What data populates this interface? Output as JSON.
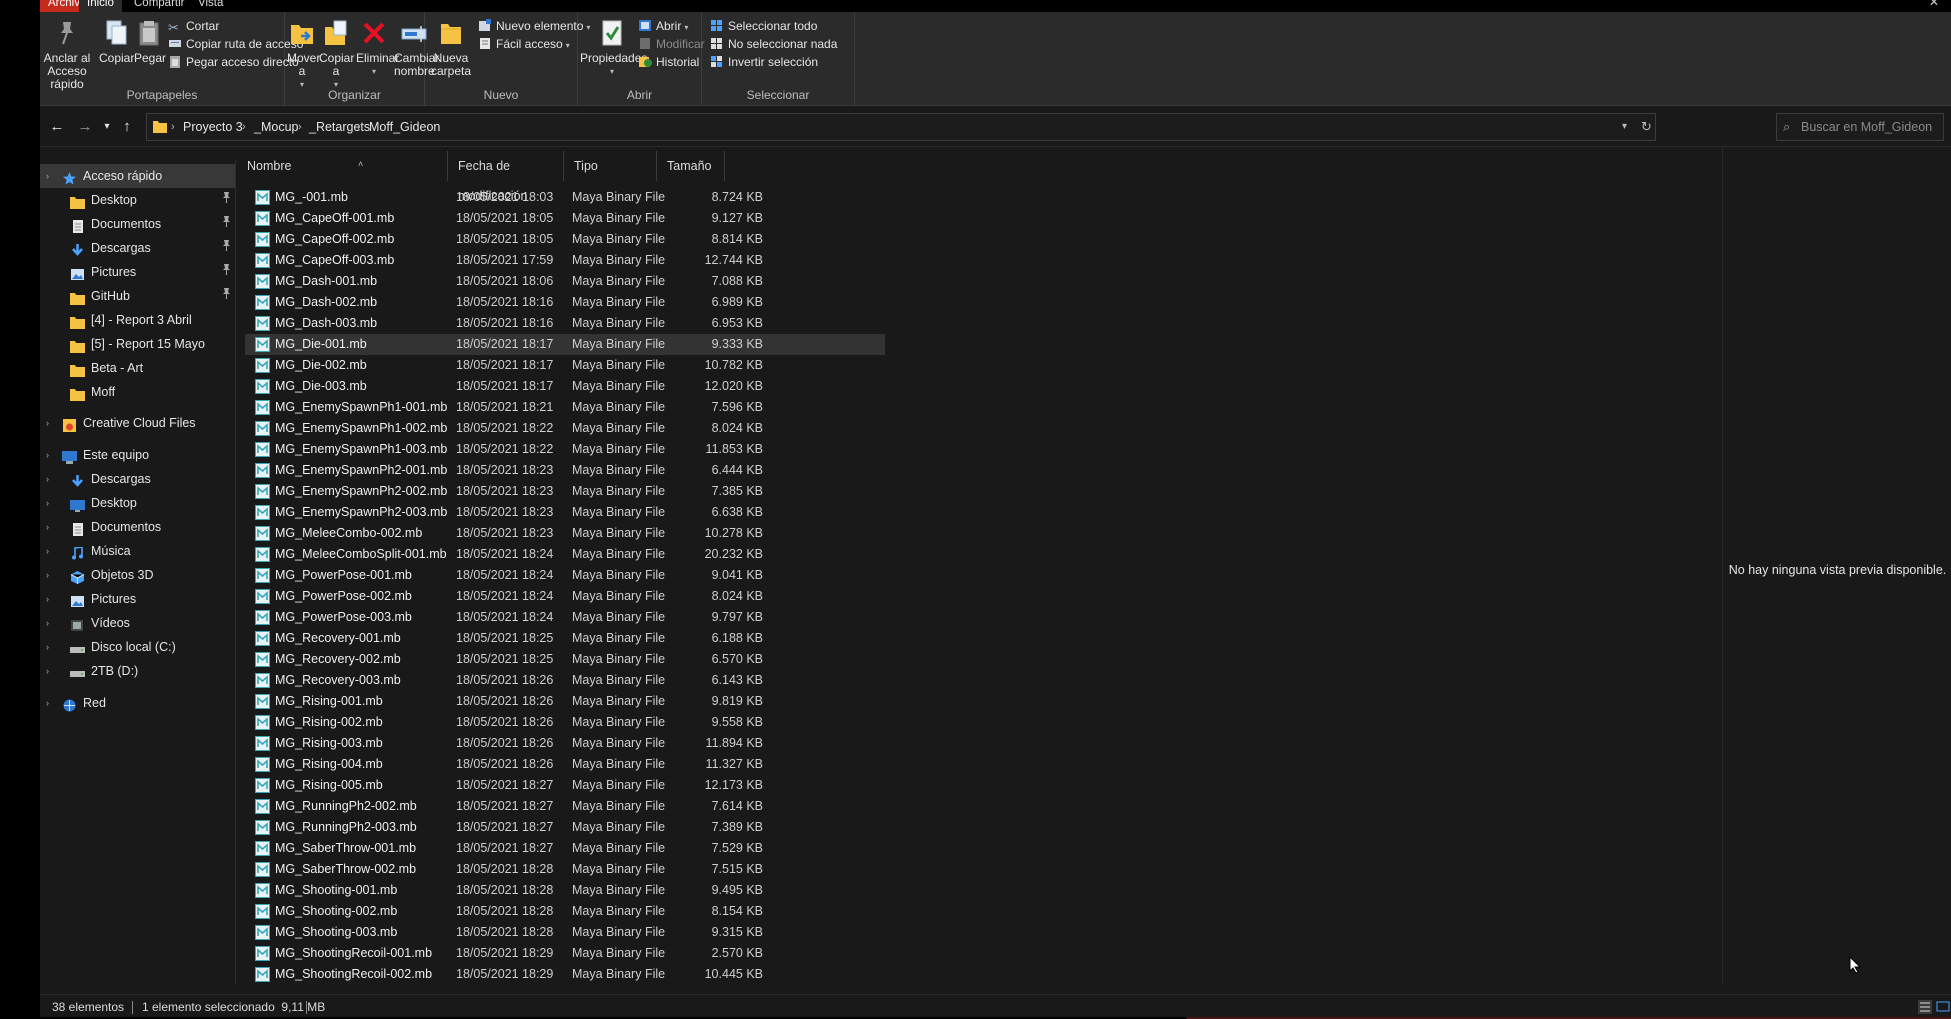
{
  "ribbon_tabs": [
    "Archivo",
    "Inicio",
    "Compartir",
    "Vista"
  ],
  "ribbon": {
    "portapapeles": {
      "label": "Portapapeles",
      "pin_label_1": "Anclar al",
      "pin_label_2": "Acceso rápido",
      "copy": "Copiar",
      "paste": "Pegar",
      "cut": "Cortar",
      "copy_path": "Copiar ruta de acceso",
      "paste_shortcut": "Pegar acceso directo"
    },
    "organizar": {
      "label": "Organizar",
      "move_1": "Mover",
      "move_2": "a",
      "copy_1": "Copiar",
      "copy_2": "a",
      "delete": "Eliminar",
      "rename_1": "Cambiar",
      "rename_2": "nombre"
    },
    "nuevo": {
      "label": "Nuevo",
      "new_folder_1": "Nueva",
      "new_folder_2": "carpeta",
      "new_item": "Nuevo elemento",
      "easy_access": "Fácil acceso"
    },
    "abrir": {
      "label": "Abrir",
      "properties": "Propiedades",
      "open": "Abrir",
      "edit": "Modificar",
      "history": "Historial"
    },
    "seleccionar": {
      "label": "Seleccionar",
      "select_all": "Seleccionar todo",
      "select_none": "No seleccionar nada",
      "invert": "Invertir selección"
    }
  },
  "breadcrumb": [
    "Proyecto 3",
    "_Mocup",
    "_Retargets",
    "Moff_Gideon"
  ],
  "search_placeholder": "Buscar en Moff_Gideon",
  "sidebar": {
    "quick_access": "Acceso rápido",
    "quick_items": [
      {
        "label": "Desktop",
        "icon": "folder-icon",
        "pinned": true
      },
      {
        "label": "Documentos",
        "icon": "documents-icon",
        "pinned": true
      },
      {
        "label": "Descargas",
        "icon": "download-icon",
        "pinned": true
      },
      {
        "label": "Pictures",
        "icon": "pictures-icon",
        "pinned": true
      },
      {
        "label": "GitHub",
        "icon": "folder-icon",
        "pinned": true
      },
      {
        "label": "[4] - Report 3 Abril",
        "icon": "folder-icon",
        "pinned": false
      },
      {
        "label": "[5] - Report 15 Mayo",
        "icon": "folder-icon",
        "pinned": false
      },
      {
        "label": "Beta - Art",
        "icon": "folder-icon",
        "pinned": false
      },
      {
        "label": "Moff",
        "icon": "folder-icon",
        "pinned": false
      }
    ],
    "creative_cloud": "Creative Cloud Files",
    "this_pc": "Este equipo",
    "pc_items": [
      {
        "label": "Descargas",
        "icon": "download-icon"
      },
      {
        "label": "Desktop",
        "icon": "desktop-icon"
      },
      {
        "label": "Documentos",
        "icon": "documents-icon"
      },
      {
        "label": "Música",
        "icon": "music-icon"
      },
      {
        "label": "Objetos 3D",
        "icon": "objects3d-icon"
      },
      {
        "label": "Pictures",
        "icon": "pictures-icon"
      },
      {
        "label": "Vídeos",
        "icon": "videos-icon"
      },
      {
        "label": "Disco local (C:)",
        "icon": "drive-icon"
      },
      {
        "label": "2TB (D:)",
        "icon": "drive-icon"
      }
    ],
    "network": "Red"
  },
  "columns": {
    "name": "Nombre",
    "date": "Fecha de modificación",
    "type": "Tipo",
    "size": "Tamaño"
  },
  "files": [
    {
      "name": "MG_-001.mb",
      "date": "18/05/2021 18:03",
      "type": "Maya Binary File",
      "size": "8.724 KB"
    },
    {
      "name": "MG_CapeOff-001.mb",
      "date": "18/05/2021 18:05",
      "type": "Maya Binary File",
      "size": "9.127 KB"
    },
    {
      "name": "MG_CapeOff-002.mb",
      "date": "18/05/2021 18:05",
      "type": "Maya Binary File",
      "size": "8.814 KB"
    },
    {
      "name": "MG_CapeOff-003.mb",
      "date": "18/05/2021 17:59",
      "type": "Maya Binary File",
      "size": "12.744 KB"
    },
    {
      "name": "MG_Dash-001.mb",
      "date": "18/05/2021 18:06",
      "type": "Maya Binary File",
      "size": "7.088 KB"
    },
    {
      "name": "MG_Dash-002.mb",
      "date": "18/05/2021 18:16",
      "type": "Maya Binary File",
      "size": "6.989 KB"
    },
    {
      "name": "MG_Dash-003.mb",
      "date": "18/05/2021 18:16",
      "type": "Maya Binary File",
      "size": "6.953 KB"
    },
    {
      "name": "MG_Die-001.mb",
      "date": "18/05/2021 18:17",
      "type": "Maya Binary File",
      "size": "9.333 KB"
    },
    {
      "name": "MG_Die-002.mb",
      "date": "18/05/2021 18:17",
      "type": "Maya Binary File",
      "size": "10.782 KB"
    },
    {
      "name": "MG_Die-003.mb",
      "date": "18/05/2021 18:17",
      "type": "Maya Binary File",
      "size": "12.020 KB"
    },
    {
      "name": "MG_EnemySpawnPh1-001.mb",
      "date": "18/05/2021 18:21",
      "type": "Maya Binary File",
      "size": "7.596 KB"
    },
    {
      "name": "MG_EnemySpawnPh1-002.mb",
      "date": "18/05/2021 18:22",
      "type": "Maya Binary File",
      "size": "8.024 KB"
    },
    {
      "name": "MG_EnemySpawnPh1-003.mb",
      "date": "18/05/2021 18:22",
      "type": "Maya Binary File",
      "size": "11.853 KB"
    },
    {
      "name": "MG_EnemySpawnPh2-001.mb",
      "date": "18/05/2021 18:23",
      "type": "Maya Binary File",
      "size": "6.444 KB"
    },
    {
      "name": "MG_EnemySpawnPh2-002.mb",
      "date": "18/05/2021 18:23",
      "type": "Maya Binary File",
      "size": "7.385 KB"
    },
    {
      "name": "MG_EnemySpawnPh2-003.mb",
      "date": "18/05/2021 18:23",
      "type": "Maya Binary File",
      "size": "6.638 KB"
    },
    {
      "name": "MG_MeleeCombo-002.mb",
      "date": "18/05/2021 18:23",
      "type": "Maya Binary File",
      "size": "10.278 KB"
    },
    {
      "name": "MG_MeleeComboSplit-001.mb",
      "date": "18/05/2021 18:24",
      "type": "Maya Binary File",
      "size": "20.232 KB"
    },
    {
      "name": "MG_PowerPose-001.mb",
      "date": "18/05/2021 18:24",
      "type": "Maya Binary File",
      "size": "9.041 KB"
    },
    {
      "name": "MG_PowerPose-002.mb",
      "date": "18/05/2021 18:24",
      "type": "Maya Binary File",
      "size": "8.024 KB"
    },
    {
      "name": "MG_PowerPose-003.mb",
      "date": "18/05/2021 18:24",
      "type": "Maya Binary File",
      "size": "9.797 KB"
    },
    {
      "name": "MG_Recovery-001.mb",
      "date": "18/05/2021 18:25",
      "type": "Maya Binary File",
      "size": "6.188 KB"
    },
    {
      "name": "MG_Recovery-002.mb",
      "date": "18/05/2021 18:25",
      "type": "Maya Binary File",
      "size": "6.570 KB"
    },
    {
      "name": "MG_Recovery-003.mb",
      "date": "18/05/2021 18:26",
      "type": "Maya Binary File",
      "size": "6.143 KB"
    },
    {
      "name": "MG_Rising-001.mb",
      "date": "18/05/2021 18:26",
      "type": "Maya Binary File",
      "size": "9.819 KB"
    },
    {
      "name": "MG_Rising-002.mb",
      "date": "18/05/2021 18:26",
      "type": "Maya Binary File",
      "size": "9.558 KB"
    },
    {
      "name": "MG_Rising-003.mb",
      "date": "18/05/2021 18:26",
      "type": "Maya Binary File",
      "size": "11.894 KB"
    },
    {
      "name": "MG_Rising-004.mb",
      "date": "18/05/2021 18:26",
      "type": "Maya Binary File",
      "size": "11.327 KB"
    },
    {
      "name": "MG_Rising-005.mb",
      "date": "18/05/2021 18:27",
      "type": "Maya Binary File",
      "size": "12.173 KB"
    },
    {
      "name": "MG_RunningPh2-002.mb",
      "date": "18/05/2021 18:27",
      "type": "Maya Binary File",
      "size": "7.614 KB"
    },
    {
      "name": "MG_RunningPh2-003.mb",
      "date": "18/05/2021 18:27",
      "type": "Maya Binary File",
      "size": "7.389 KB"
    },
    {
      "name": "MG_SaberThrow-001.mb",
      "date": "18/05/2021 18:27",
      "type": "Maya Binary File",
      "size": "7.529 KB"
    },
    {
      "name": "MG_SaberThrow-002.mb",
      "date": "18/05/2021 18:28",
      "type": "Maya Binary File",
      "size": "7.515 KB"
    },
    {
      "name": "MG_Shooting-001.mb",
      "date": "18/05/2021 18:28",
      "type": "Maya Binary File",
      "size": "9.495 KB"
    },
    {
      "name": "MG_Shooting-002.mb",
      "date": "18/05/2021 18:28",
      "type": "Maya Binary File",
      "size": "8.154 KB"
    },
    {
      "name": "MG_Shooting-003.mb",
      "date": "18/05/2021 18:28",
      "type": "Maya Binary File",
      "size": "9.315 KB"
    },
    {
      "name": "MG_ShootingRecoil-001.mb",
      "date": "18/05/2021 18:29",
      "type": "Maya Binary File",
      "size": "2.570 KB"
    },
    {
      "name": "MG_ShootingRecoil-002.mb",
      "date": "18/05/2021 18:29",
      "type": "Maya Binary File",
      "size": "10.445 KB"
    }
  ],
  "selected_file_index": 7,
  "preview_message": "No hay ninguna vista previa disponible.",
  "status": {
    "count": "38 elementos",
    "selection": "1 elemento seleccionado  9,11 MB"
  },
  "colors": {
    "accent": "#4aa3ff",
    "folder": "#f6c243",
    "file_tab": "#c42b1c",
    "delete": "#e81123",
    "maya_icon": "#3aa6b9"
  }
}
